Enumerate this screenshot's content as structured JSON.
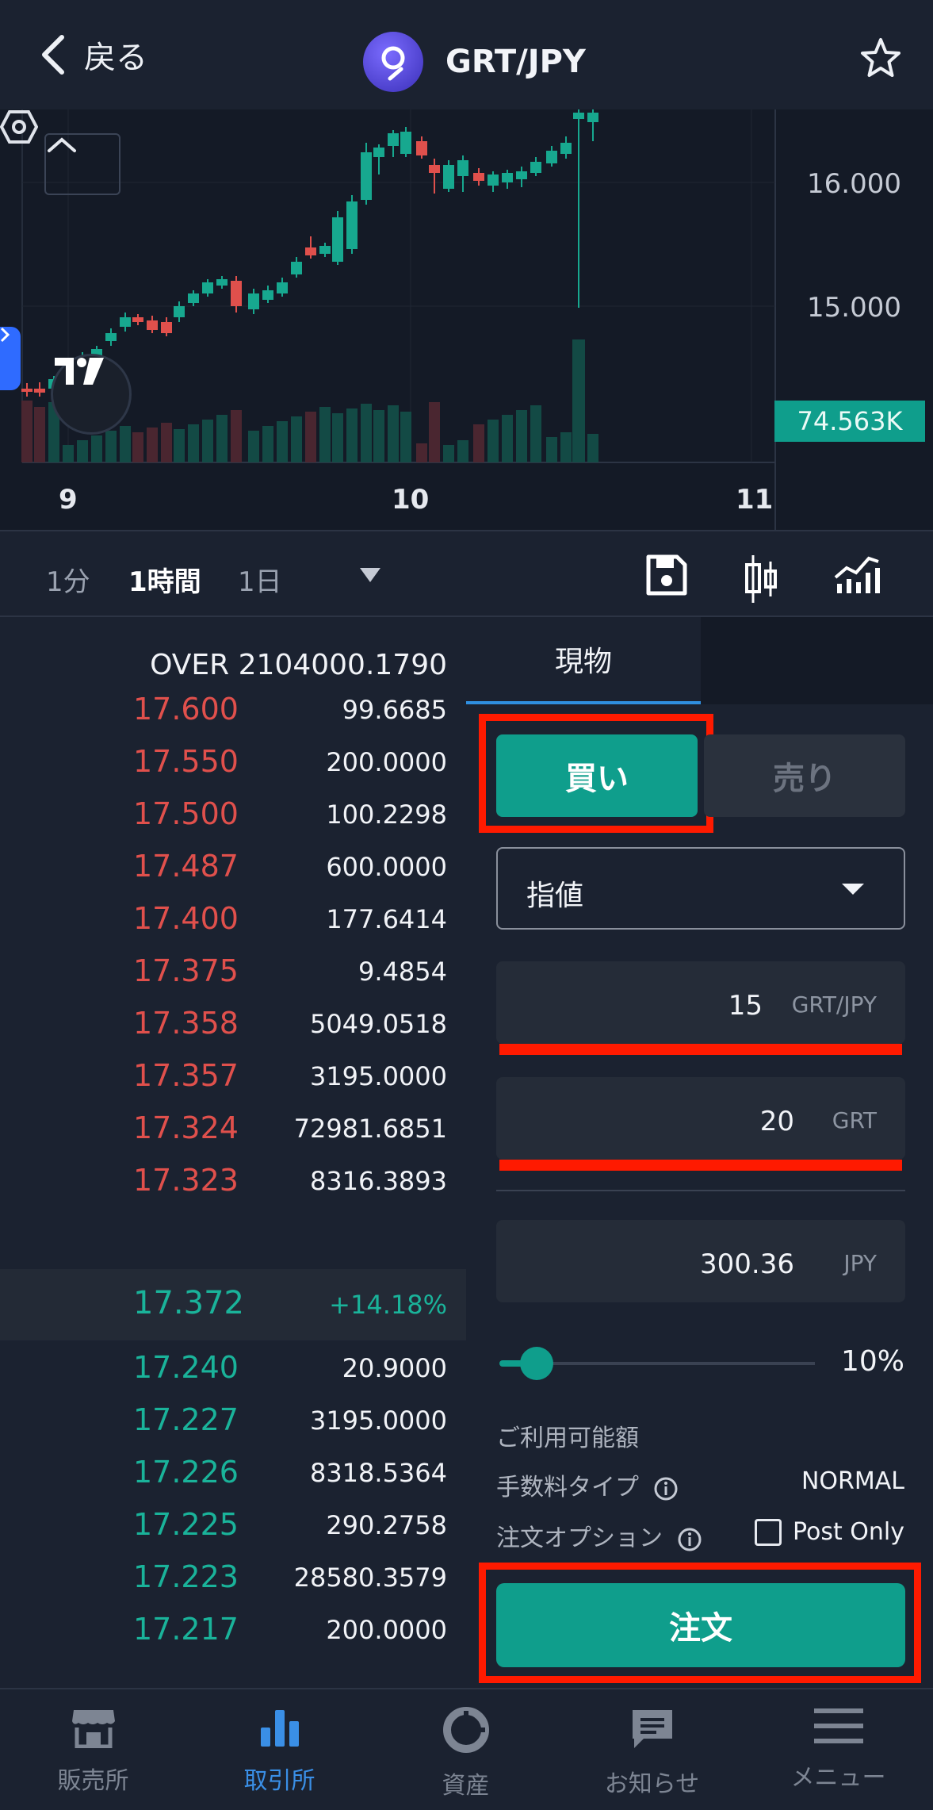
{
  "header": {
    "back_label": "戻る",
    "pair_title": "GRT/JPY"
  },
  "chart": {
    "price_labels": [
      "16.000",
      "15.000"
    ],
    "volume_badge": "74.563K",
    "x_labels": [
      "9",
      "10",
      "11"
    ]
  },
  "toolbar": {
    "timeframes": [
      "1分",
      "1時間",
      "1日"
    ],
    "active_timeframe": "1時間"
  },
  "orderbook": {
    "over_label": "OVER",
    "over_value": "2104000.1790",
    "asks": [
      {
        "price": "17.600",
        "qty": "99.6685"
      },
      {
        "price": "17.550",
        "qty": "200.0000"
      },
      {
        "price": "17.500",
        "qty": "100.2298"
      },
      {
        "price": "17.487",
        "qty": "600.0000"
      },
      {
        "price": "17.400",
        "qty": "177.6414"
      },
      {
        "price": "17.375",
        "qty": "9.4854"
      },
      {
        "price": "17.358",
        "qty": "5049.0518"
      },
      {
        "price": "17.357",
        "qty": "3195.0000"
      },
      {
        "price": "17.324",
        "qty": "72981.6851"
      },
      {
        "price": "17.323",
        "qty": "8316.3893"
      }
    ],
    "last_price": "17.372",
    "change": "+14.18%",
    "bids": [
      {
        "price": "17.240",
        "qty": "20.9000"
      },
      {
        "price": "17.227",
        "qty": "3195.0000"
      },
      {
        "price": "17.226",
        "qty": "8318.5364"
      },
      {
        "price": "17.225",
        "qty": "290.2758"
      },
      {
        "price": "17.223",
        "qty": "28580.3579"
      },
      {
        "price": "17.217",
        "qty": "200.0000"
      }
    ]
  },
  "order_panel": {
    "tab_spot": "現物",
    "buy_label": "買い",
    "sell_label": "売り",
    "order_type": "指値",
    "price_value": "15",
    "price_unit": "GRT/JPY",
    "amount_value": "20",
    "amount_unit": "GRT",
    "total_value": "300.36",
    "total_unit": "JPY",
    "slider_percent": "10%",
    "slider_fraction": 0.1,
    "available_label": "ご利用可能額",
    "fee_type_label": "手数料タイプ",
    "fee_type_value": "NORMAL",
    "order_option_label": "注文オプション",
    "post_only_label": "Post Only",
    "order_button": "注文"
  },
  "nav": {
    "items": [
      {
        "label": "販売所",
        "icon": "store-icon"
      },
      {
        "label": "取引所",
        "icon": "bar-chart-icon"
      },
      {
        "label": "資産",
        "icon": "pie-chart-icon"
      },
      {
        "label": "お知らせ",
        "icon": "message-icon"
      },
      {
        "label": "メニュー",
        "icon": "menu-icon"
      }
    ],
    "active": "取引所"
  },
  "colors": {
    "accent_green": "#0f9e8c",
    "ask_red": "#e0504c",
    "bid_green": "#1ab39a",
    "highlight_red": "#ff1a00",
    "active_blue": "#3a8fe6"
  }
}
